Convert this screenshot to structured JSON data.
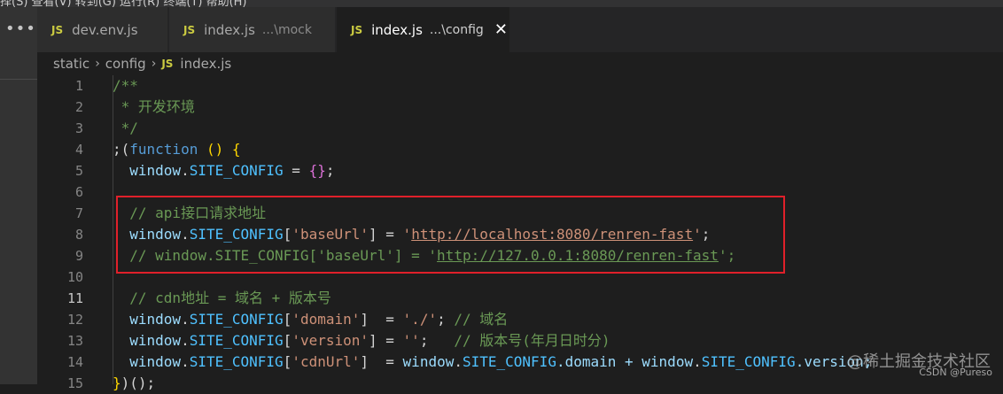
{
  "menubar": {
    "text": "择(S) 查看(V) 转到(G) 运行(R) 终端(T) 帮助(H)"
  },
  "tabs": [
    {
      "icon": "JS",
      "name": "dev.env.js",
      "path": "",
      "active": false
    },
    {
      "icon": "JS",
      "name": "index.js",
      "path": "...\\mock",
      "active": false
    },
    {
      "icon": "JS",
      "name": "index.js",
      "path": "...\\config",
      "active": true,
      "close": "✕"
    }
  ],
  "breadcrumb": {
    "parts": [
      "static",
      "config"
    ],
    "file_icon": "JS",
    "file": "index.js",
    "separator": "›"
  },
  "editor": {
    "current_line": 11,
    "line_numbers": [
      "1",
      "2",
      "3",
      "4",
      "5",
      "6",
      "7",
      "8",
      "9",
      "10",
      "11",
      "12",
      "13",
      "14",
      "15"
    ]
  },
  "code": {
    "l1": "/**",
    "l2": " * 开发环境",
    "l3": " */",
    "l4_a": ";(",
    "l4_b": "function",
    "l4_c": " () {",
    "l5_a": "  window",
    "l5_b": ".",
    "l5_c": "SITE_CONFIG",
    "l5_d": " = ",
    "l5_e": "{}",
    "l5_f": ";",
    "l7": "  // api接口请求地址",
    "l8_a": "  window",
    "l8_b": ".",
    "l8_c": "SITE_CONFIG",
    "l8_d": "[",
    "l8_e": "'baseUrl'",
    "l8_f": "] = ",
    "l8_g": "'",
    "l8_h": "http://localhost:8080/renren-fast",
    "l8_i": "'",
    "l8_j": ";",
    "l9_a": "  // window.SITE_CONFIG['baseUrl'] = '",
    "l9_b": "http://127.0.0.1:8080/renren-fast",
    "l9_c": "';",
    "l11": "  // cdn地址 = 域名 + 版本号",
    "l12_a": "  window",
    "l12_b": ".",
    "l12_c": "SITE_CONFIG",
    "l12_d": "[",
    "l12_e": "'domain'",
    "l12_f": "]  = ",
    "l12_g": "'./'",
    "l12_h": "; ",
    "l12_i": "// 域名",
    "l13_a": "  window",
    "l13_b": ".",
    "l13_c": "SITE_CONFIG",
    "l13_d": "[",
    "l13_e": "'version'",
    "l13_f": "] = ",
    "l13_g": "''",
    "l13_h": ";   ",
    "l13_i": "// 版本号(年月日时分)",
    "l14_a": "  window",
    "l14_b": ".",
    "l14_c": "SITE_CONFIG",
    "l14_d": "[",
    "l14_e": "'cdnUrl'",
    "l14_f": "]  = ",
    "l14_g": "window",
    "l14_h": ".",
    "l14_i": "SITE_CONFIG",
    "l14_j": ".domain + ",
    "l14_k": "window",
    "l14_l": ".",
    "l14_m": "SITE_CONFIG",
    "l14_n": ".version;",
    "l15_a": "}",
    "l15_b": ")",
    "l15_c": "();"
  },
  "watermark": "@稀土掘金技术社区",
  "csdn": "CSDN @Pureso",
  "colors": {
    "comment": "#6a9955",
    "keyword": "#569cd6",
    "string": "#ce9178",
    "highlight_box": "#e0202a"
  }
}
